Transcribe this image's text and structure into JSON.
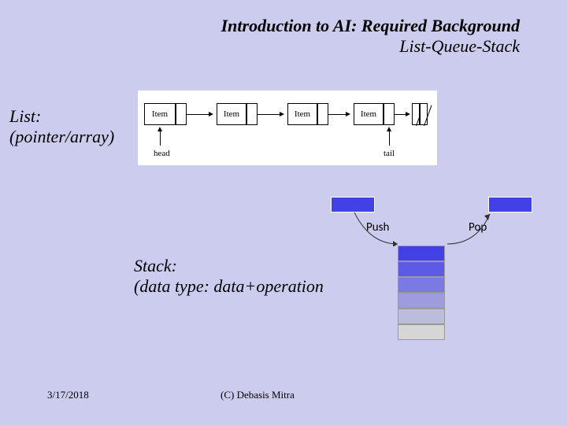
{
  "title": {
    "line1": "Introduction to AI: Required Background",
    "line2": "List-Queue-Stack"
  },
  "list": {
    "label_line1": "List:",
    "label_line2": "(pointer/array)",
    "nodes": [
      "Item",
      "Item",
      "Item",
      "Item"
    ],
    "head_label": "head",
    "tail_label": "tail"
  },
  "stack": {
    "label_line1": "Stack:",
    "label_line2": "(data type: data+operation",
    "push_label": "Push",
    "pop_label": "Pop",
    "cell_count": 6
  },
  "footer": {
    "date": "3/17/2018",
    "copyright": "(C) Debasis Mitra"
  }
}
